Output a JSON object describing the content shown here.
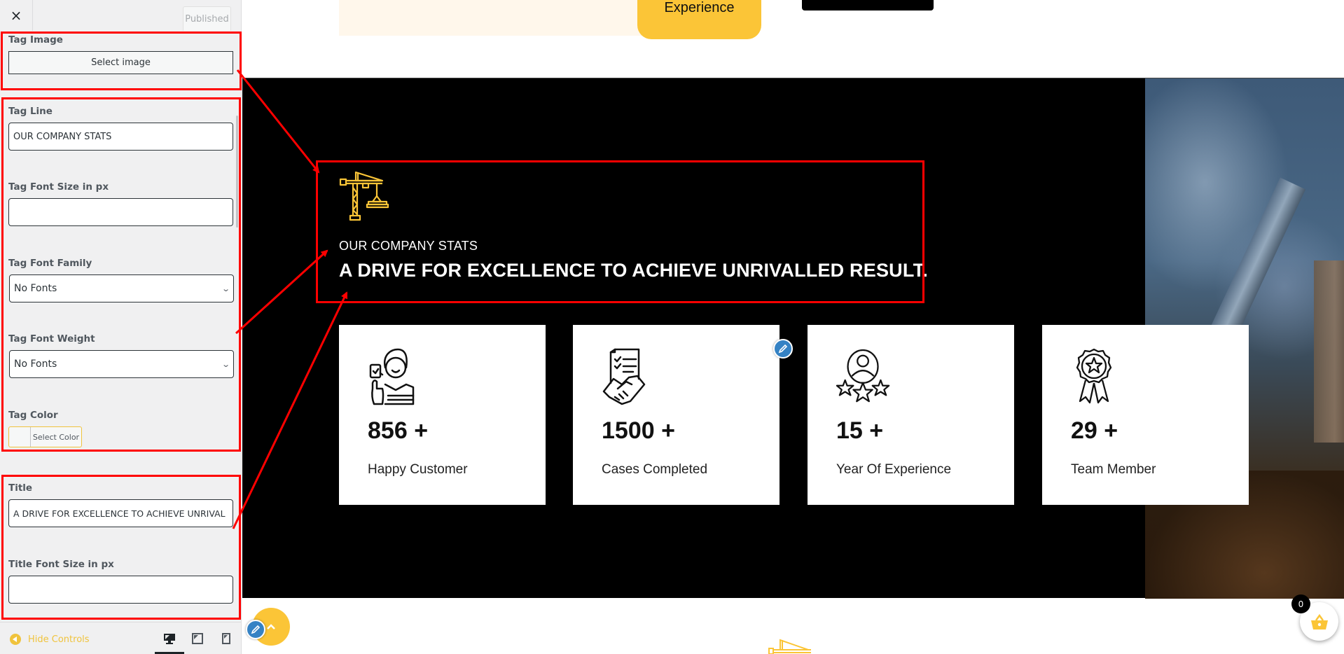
{
  "sidebar": {
    "close_label": "×",
    "publish_status": "Published",
    "tag_image": {
      "label": "Tag Image",
      "button": "Select image"
    },
    "tag_line": {
      "label": "Tag Line",
      "value": "OUR COMPANY STATS"
    },
    "tag_font_size": {
      "label": "Tag Font Size in px",
      "value": ""
    },
    "tag_font_family": {
      "label": "Tag Font Family",
      "selected": "No Fonts"
    },
    "tag_font_weight": {
      "label": "Tag Font Weight",
      "selected": "No Fonts"
    },
    "tag_color": {
      "label": "Tag Color",
      "button": "Select Color"
    },
    "title": {
      "label": "Title",
      "value": "A DRIVE FOR EXCELLENCE TO ACHIEVE UNRIVAL"
    },
    "title_font_size": {
      "label": "Title Font Size in px",
      "value": ""
    },
    "footer": {
      "hide_controls": "Hide Controls",
      "devices": [
        "desktop",
        "tablet",
        "mobile"
      ],
      "active_device": "desktop"
    }
  },
  "preview": {
    "top_button": "Experience",
    "section": {
      "icon": "crane-icon",
      "tag_line": "OUR COMPANY STATS",
      "title": "A DRIVE FOR EXCELLENCE TO ACHIEVE UNRIVALLED RESULT."
    },
    "stats": [
      {
        "icon": "happy-customer-icon",
        "value": "856",
        "suffix": "+",
        "label": "Happy Customer"
      },
      {
        "icon": "handshake-contract-icon",
        "value": "1500",
        "suffix": "+",
        "label": "Cases Completed"
      },
      {
        "icon": "rating-stars-icon",
        "value": "15",
        "suffix": "+",
        "label": "Year Of Experience"
      },
      {
        "icon": "award-badge-icon",
        "value": "29",
        "suffix": "+",
        "label": "Team Member"
      }
    ],
    "cart_count": "0"
  },
  "colors": {
    "accent": "#fbc537",
    "annotation": "#ff0000",
    "edit": "#3582c4",
    "section_bg": "#000000"
  }
}
